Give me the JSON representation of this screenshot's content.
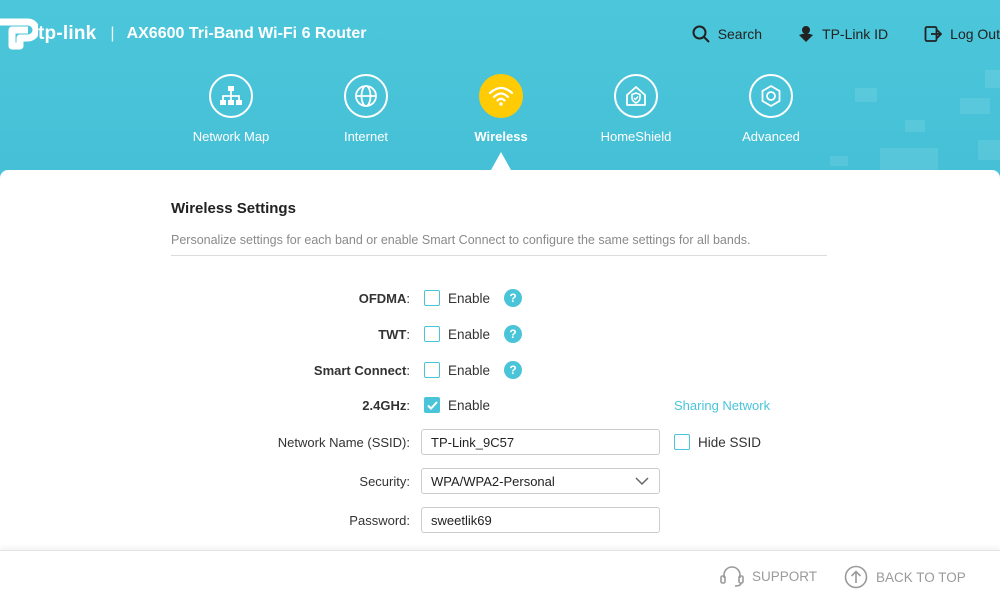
{
  "header": {
    "logo_text": "tp-link",
    "separator": "|",
    "model": "AX6600 Tri-Band Wi-Fi 6 Router",
    "actions": {
      "search": "Search",
      "tplink_id": "TP-Link ID",
      "logout": "Log Out"
    }
  },
  "nav": {
    "items": [
      {
        "label": "Network Map",
        "icon": "network-map-icon"
      },
      {
        "label": "Internet",
        "icon": "globe-icon"
      },
      {
        "label": "Wireless",
        "icon": "wifi-icon",
        "active": true
      },
      {
        "label": "HomeShield",
        "icon": "home-shield-icon"
      },
      {
        "label": "Advanced",
        "icon": "gear-icon"
      }
    ]
  },
  "section": {
    "title": "Wireless Settings",
    "description": "Personalize settings for each band or enable Smart Connect to configure the same settings for all bands."
  },
  "form": {
    "ofdma": {
      "label": "OFDMA",
      "option": "Enable",
      "checked": false
    },
    "twt": {
      "label": "TWT",
      "option": "Enable",
      "checked": false
    },
    "smart_connect": {
      "label": "Smart Connect",
      "option": "Enable",
      "checked": false
    },
    "band24": {
      "label": "2.4GHz",
      "option": "Enable",
      "checked": true,
      "link": "Sharing Network"
    },
    "ssid": {
      "label": "Network Name (SSID)",
      "value": "TP-Link_9C57",
      "hide_label": "Hide SSID"
    },
    "security": {
      "label": "Security",
      "value": "WPA/WPA2-Personal"
    },
    "password": {
      "label": "Password",
      "value": "sweetlik69"
    },
    "colon": ":",
    "help_glyph": "?"
  },
  "footer": {
    "support": "SUPPORT",
    "back_to_top": "BACK TO TOP"
  },
  "colors": {
    "accent": "#4ac4d9",
    "active_nav": "#ffcb05",
    "link": "#4ac4d9"
  }
}
